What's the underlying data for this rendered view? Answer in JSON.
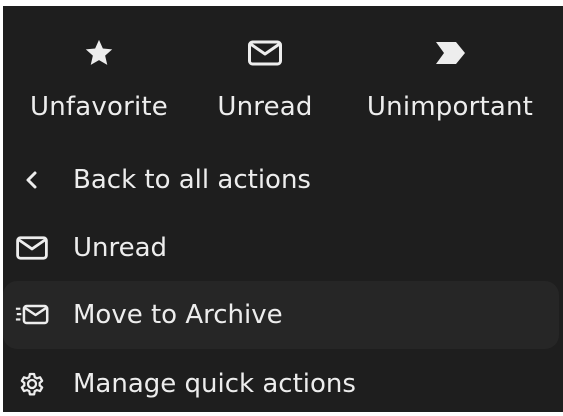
{
  "quick_actions": [
    {
      "label": "Unfavorite",
      "icon": "star-icon"
    },
    {
      "label": "Unread",
      "icon": "envelope-icon"
    },
    {
      "label": "Unimportant",
      "icon": "important-tag-icon"
    }
  ],
  "menu": {
    "back_label": "Back to all actions",
    "items": [
      {
        "label": "Unread",
        "icon": "envelope-icon"
      },
      {
        "label": "Move to Archive",
        "icon": "move-to-archive-icon"
      },
      {
        "label": "Manage quick actions",
        "icon": "gear-icon"
      }
    ]
  },
  "colors": {
    "background": "#1e1e1e",
    "text": "#ededed",
    "hover_row": "#262626"
  }
}
